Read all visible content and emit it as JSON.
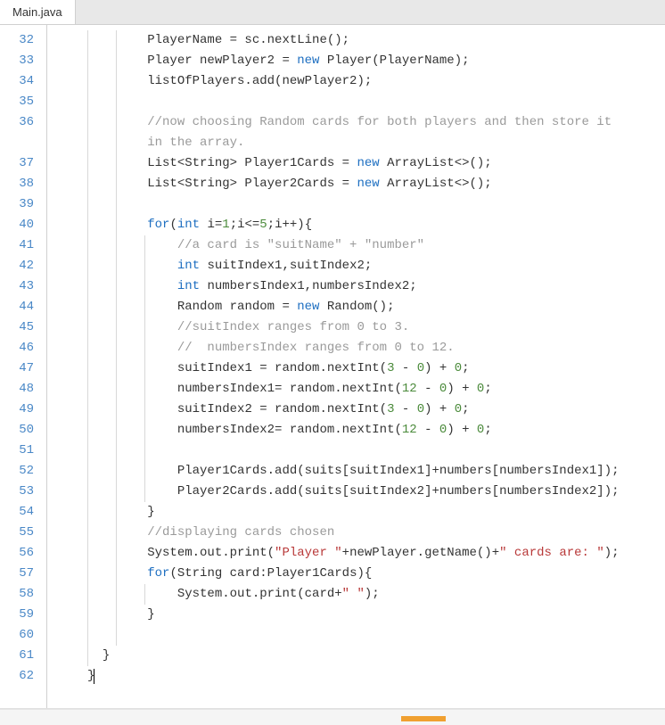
{
  "tab": {
    "filename": "Main.java"
  },
  "lines": [
    {
      "n": 32,
      "indent": [
        0,
        32
      ],
      "segs": [
        [
          "id",
          "PlayerName = sc.nextLine();"
        ]
      ]
    },
    {
      "n": 33,
      "indent": [
        0,
        32
      ],
      "segs": [
        [
          "id",
          "Player newPlayer2 = "
        ],
        [
          "kw",
          "new"
        ],
        [
          "id",
          " Player(PlayerName);"
        ]
      ]
    },
    {
      "n": 34,
      "indent": [
        0,
        32
      ],
      "segs": [
        [
          "id",
          "listOfPlayers.add(newPlayer2);"
        ]
      ]
    },
    {
      "n": 35,
      "indent": [
        0,
        32
      ],
      "segs": []
    },
    {
      "n": 36,
      "indent": [
        0,
        32
      ],
      "segs": [
        [
          "cmt",
          "//now choosing Random cards for both players and then store it"
        ]
      ]
    },
    {
      "n": -1,
      "indent": [
        0,
        32
      ],
      "segs": [
        [
          "cmt",
          "in the array."
        ]
      ]
    },
    {
      "n": 37,
      "indent": [
        0,
        32
      ],
      "segs": [
        [
          "id",
          "List<String> Player1Cards = "
        ],
        [
          "kw",
          "new"
        ],
        [
          "id",
          " ArrayList<>();"
        ]
      ]
    },
    {
      "n": 38,
      "indent": [
        0,
        32
      ],
      "segs": [
        [
          "id",
          "List<String> Player2Cards = "
        ],
        [
          "kw",
          "new"
        ],
        [
          "id",
          " ArrayList<>();"
        ]
      ]
    },
    {
      "n": 39,
      "indent": [
        0,
        32
      ],
      "segs": []
    },
    {
      "n": 40,
      "indent": [
        0,
        32
      ],
      "segs": [
        [
          "kw",
          "for"
        ],
        [
          "id",
          "("
        ],
        [
          "kw",
          "int"
        ],
        [
          "id",
          " i="
        ],
        [
          "num",
          "1"
        ],
        [
          "id",
          ";i<="
        ],
        [
          "num",
          "5"
        ],
        [
          "id",
          ";i++){"
        ]
      ]
    },
    {
      "n": 41,
      "indent": [
        0,
        32,
        64
      ],
      "segs": [
        [
          "cmt",
          "//a card is \"suitName\" + \"number\""
        ]
      ]
    },
    {
      "n": 42,
      "indent": [
        0,
        32,
        64
      ],
      "segs": [
        [
          "kw",
          "int"
        ],
        [
          "id",
          " suitIndex1,suitIndex2;"
        ]
      ]
    },
    {
      "n": 43,
      "indent": [
        0,
        32,
        64
      ],
      "segs": [
        [
          "kw",
          "int"
        ],
        [
          "id",
          " numbersIndex1,numbersIndex2;"
        ]
      ]
    },
    {
      "n": 44,
      "indent": [
        0,
        32,
        64
      ],
      "segs": [
        [
          "id",
          "Random random = "
        ],
        [
          "kw",
          "new"
        ],
        [
          "id",
          " Random();"
        ]
      ]
    },
    {
      "n": 45,
      "indent": [
        0,
        32,
        64
      ],
      "segs": [
        [
          "cmt",
          "//suitIndex ranges from 0 to 3."
        ]
      ]
    },
    {
      "n": 46,
      "indent": [
        0,
        32,
        64
      ],
      "segs": [
        [
          "cmt",
          "//  numbersIndex ranges from 0 to 12."
        ]
      ]
    },
    {
      "n": 47,
      "indent": [
        0,
        32,
        64
      ],
      "segs": [
        [
          "id",
          "suitIndex1 = random.nextInt("
        ],
        [
          "num",
          "3"
        ],
        [
          "id",
          " - "
        ],
        [
          "num",
          "0"
        ],
        [
          "id",
          ") + "
        ],
        [
          "num",
          "0"
        ],
        [
          "id",
          ";"
        ]
      ]
    },
    {
      "n": 48,
      "indent": [
        0,
        32,
        64
      ],
      "segs": [
        [
          "id",
          "numbersIndex1= random.nextInt("
        ],
        [
          "num",
          "12"
        ],
        [
          "id",
          " - "
        ],
        [
          "num",
          "0"
        ],
        [
          "id",
          ") + "
        ],
        [
          "num",
          "0"
        ],
        [
          "id",
          ";"
        ]
      ]
    },
    {
      "n": 49,
      "indent": [
        0,
        32,
        64
      ],
      "segs": [
        [
          "id",
          "suitIndex2 = random.nextInt("
        ],
        [
          "num",
          "3"
        ],
        [
          "id",
          " - "
        ],
        [
          "num",
          "0"
        ],
        [
          "id",
          ") + "
        ],
        [
          "num",
          "0"
        ],
        [
          "id",
          ";"
        ]
      ]
    },
    {
      "n": 50,
      "indent": [
        0,
        32,
        64
      ],
      "segs": [
        [
          "id",
          "numbersIndex2= random.nextInt("
        ],
        [
          "num",
          "12"
        ],
        [
          "id",
          " - "
        ],
        [
          "num",
          "0"
        ],
        [
          "id",
          ") + "
        ],
        [
          "num",
          "0"
        ],
        [
          "id",
          ";"
        ]
      ]
    },
    {
      "n": 51,
      "indent": [
        0,
        32,
        64
      ],
      "segs": []
    },
    {
      "n": 52,
      "indent": [
        0,
        32,
        64
      ],
      "segs": [
        [
          "id",
          "Player1Cards.add(suits[suitIndex1]+numbers[numbersIndex1]);"
        ]
      ]
    },
    {
      "n": 53,
      "indent": [
        0,
        32,
        64
      ],
      "segs": [
        [
          "id",
          "Player2Cards.add(suits[suitIndex2]+numbers[numbersIndex2]);"
        ]
      ]
    },
    {
      "n": 54,
      "indent": [
        0,
        32
      ],
      "segs": [
        [
          "id",
          "}"
        ]
      ]
    },
    {
      "n": 55,
      "indent": [
        0,
        32
      ],
      "segs": [
        [
          "cmt",
          "//displaying cards chosen"
        ]
      ]
    },
    {
      "n": 56,
      "indent": [
        0,
        32
      ],
      "segs": [
        [
          "id",
          "System.out.print("
        ],
        [
          "str",
          "\"Player \""
        ],
        [
          "id",
          "+newPlayer.getName()+"
        ],
        [
          "str",
          "\" cards are: \""
        ],
        [
          "id",
          ");"
        ]
      ]
    },
    {
      "n": 57,
      "indent": [
        0,
        32
      ],
      "segs": [
        [
          "kw",
          "for"
        ],
        [
          "id",
          "(String card:Player1Cards){"
        ]
      ]
    },
    {
      "n": 58,
      "indent": [
        0,
        32,
        64
      ],
      "segs": [
        [
          "id",
          "System.out.print(card+"
        ],
        [
          "str",
          "\" \""
        ],
        [
          "id",
          ");"
        ]
      ]
    },
    {
      "n": 59,
      "indent": [
        0,
        32
      ],
      "segs": [
        [
          "id",
          "}"
        ]
      ]
    },
    {
      "n": 60,
      "indent": [
        0,
        32
      ],
      "segs": []
    },
    {
      "n": 61,
      "indent": [
        0
      ],
      "segs": [
        [
          "id",
          "}"
        ]
      ],
      "lead": 16
    },
    {
      "n": 62,
      "indent": [],
      "segs": [
        [
          "id",
          "}"
        ]
      ],
      "lead": 0,
      "cursor": true
    }
  ]
}
